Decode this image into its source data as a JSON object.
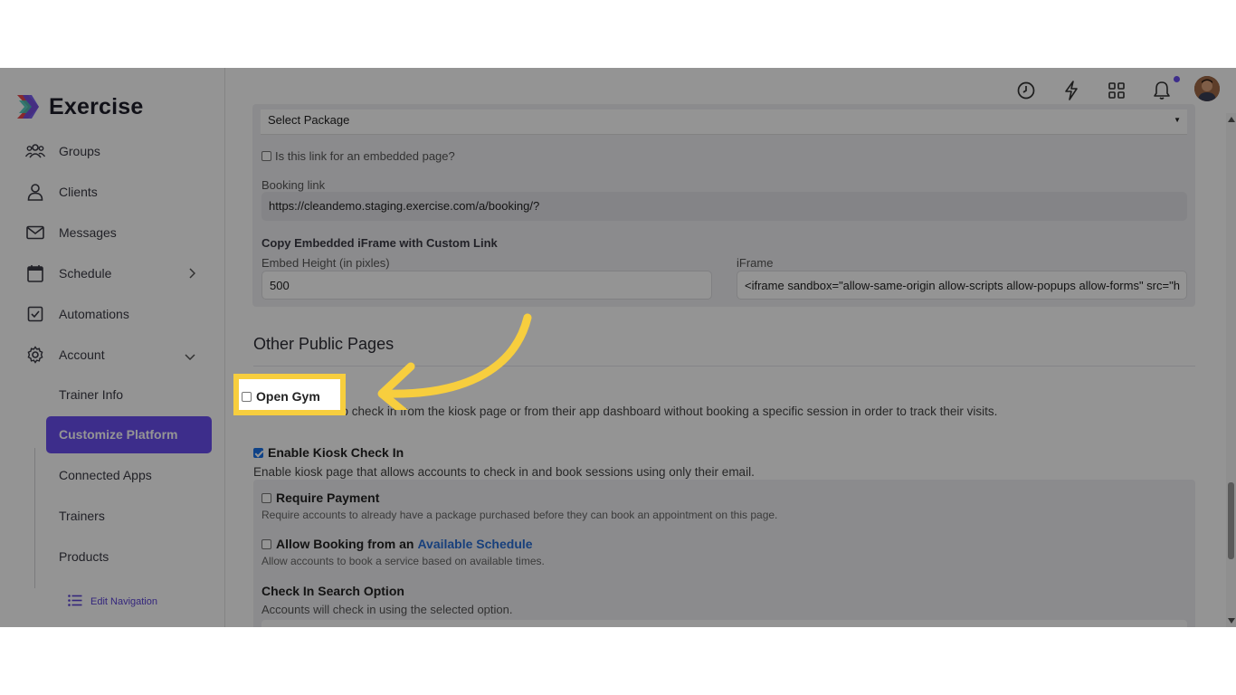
{
  "app": {
    "name": "Exercise"
  },
  "colors": {
    "accent": "#6a4ff0",
    "highlight": "#f7ce3e",
    "link": "#2a6fd6",
    "notification_dot": "#6a4ff0"
  },
  "sidebar": {
    "items": [
      {
        "label": "Groups",
        "icon": "groups-icon"
      },
      {
        "label": "Clients",
        "icon": "user-icon"
      },
      {
        "label": "Messages",
        "icon": "mail-icon"
      },
      {
        "label": "Schedule",
        "icon": "calendar-icon"
      },
      {
        "label": "Automations",
        "icon": "checkbox-icon"
      },
      {
        "label": "Account",
        "icon": "gear-icon"
      }
    ],
    "account_sub": [
      "Trainer Info",
      "Customize Platform",
      "Connected Apps",
      "Trainers",
      "Products"
    ],
    "active_sub": "Customize Platform",
    "edit_navigation": "Edit Navigation"
  },
  "topbar": {
    "icons": [
      "history-icon",
      "lightning-icon",
      "apps-grid-icon",
      "bell-icon"
    ]
  },
  "booking": {
    "package_select": "Select Package",
    "embedded_checkbox_label": "Is this link for an embedded page?",
    "embedded_checked": false,
    "booking_link_label": "Booking link",
    "booking_link_value": "https://cleandemo.staging.exercise.com/a/booking/?",
    "iframe_section_title": "Copy Embedded iFrame with Custom Link",
    "embed_height_label": "Embed Height (in pixles)",
    "embed_height_value": "500",
    "iframe_label": "iFrame",
    "iframe_value": "<iframe sandbox=\"allow-same-origin allow-scripts allow-popups allow-forms\" src=\"h"
  },
  "public_pages": {
    "title": "Other Public Pages",
    "open_gym": {
      "label": "Open Gym",
      "checked": false,
      "description": "Allow accounts to check in from the kiosk page or from their app dashboard without booking a specific session in order to track their visits."
    },
    "kiosk": {
      "label": "Enable Kiosk Check In",
      "checked": true,
      "description": "Enable kiosk page that allows accounts to check in and book sessions using only their email."
    },
    "require_payment": {
      "label": "Require Payment",
      "checked": false,
      "description": "Require accounts to already have a package purchased before they can book an appointment on this page."
    },
    "allow_booking": {
      "label_prefix": "Allow Booking from an",
      "label_link": "Available Schedule",
      "checked": false,
      "description": "Allow accounts to book a service based on available times."
    },
    "check_in_search": {
      "label": "Check In Search Option",
      "description": "Accounts will check in using the selected option."
    }
  }
}
